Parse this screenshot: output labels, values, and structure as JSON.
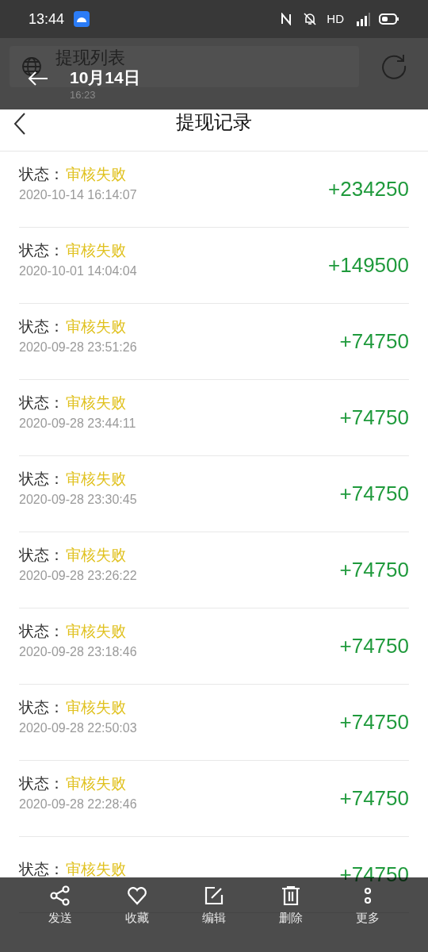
{
  "status_bar": {
    "time": "13:44",
    "network": "HD"
  },
  "browser": {
    "page_title": "提现列表",
    "overlay_date": "10月14日",
    "overlay_time": "16:23"
  },
  "page": {
    "title": "提现记录"
  },
  "records": [
    {
      "label": "状态：",
      "status": "审核失败",
      "datetime": "2020-10-14 16:14:07",
      "amount": "+234250"
    },
    {
      "label": "状态：",
      "status": "审核失败",
      "datetime": "2020-10-01 14:04:04",
      "amount": "+149500"
    },
    {
      "label": "状态：",
      "status": "审核失败",
      "datetime": "2020-09-28 23:51:26",
      "amount": "+74750"
    },
    {
      "label": "状态：",
      "status": "审核失败",
      "datetime": "2020-09-28 23:44:11",
      "amount": "+74750"
    },
    {
      "label": "状态：",
      "status": "审核失败",
      "datetime": "2020-09-28 23:30:45",
      "amount": "+74750"
    },
    {
      "label": "状态：",
      "status": "审核失败",
      "datetime": "2020-09-28 23:26:22",
      "amount": "+74750"
    },
    {
      "label": "状态：",
      "status": "审核失败",
      "datetime": "2020-09-28 23:18:46",
      "amount": "+74750"
    },
    {
      "label": "状态：",
      "status": "审核失败",
      "datetime": "2020-09-28 22:50:03",
      "amount": "+74750"
    },
    {
      "label": "状态：",
      "status": "审核失败",
      "datetime": "2020-09-28 22:28:46",
      "amount": "+74750"
    },
    {
      "label": "状态：",
      "status": "审核失败",
      "amount": "+74750"
    }
  ],
  "actions": [
    {
      "kind": "share",
      "label": "发送"
    },
    {
      "kind": "favorite",
      "label": "收藏"
    },
    {
      "kind": "edit",
      "label": "编辑"
    },
    {
      "kind": "delete",
      "label": "删除"
    },
    {
      "kind": "more",
      "label": "更多"
    }
  ]
}
